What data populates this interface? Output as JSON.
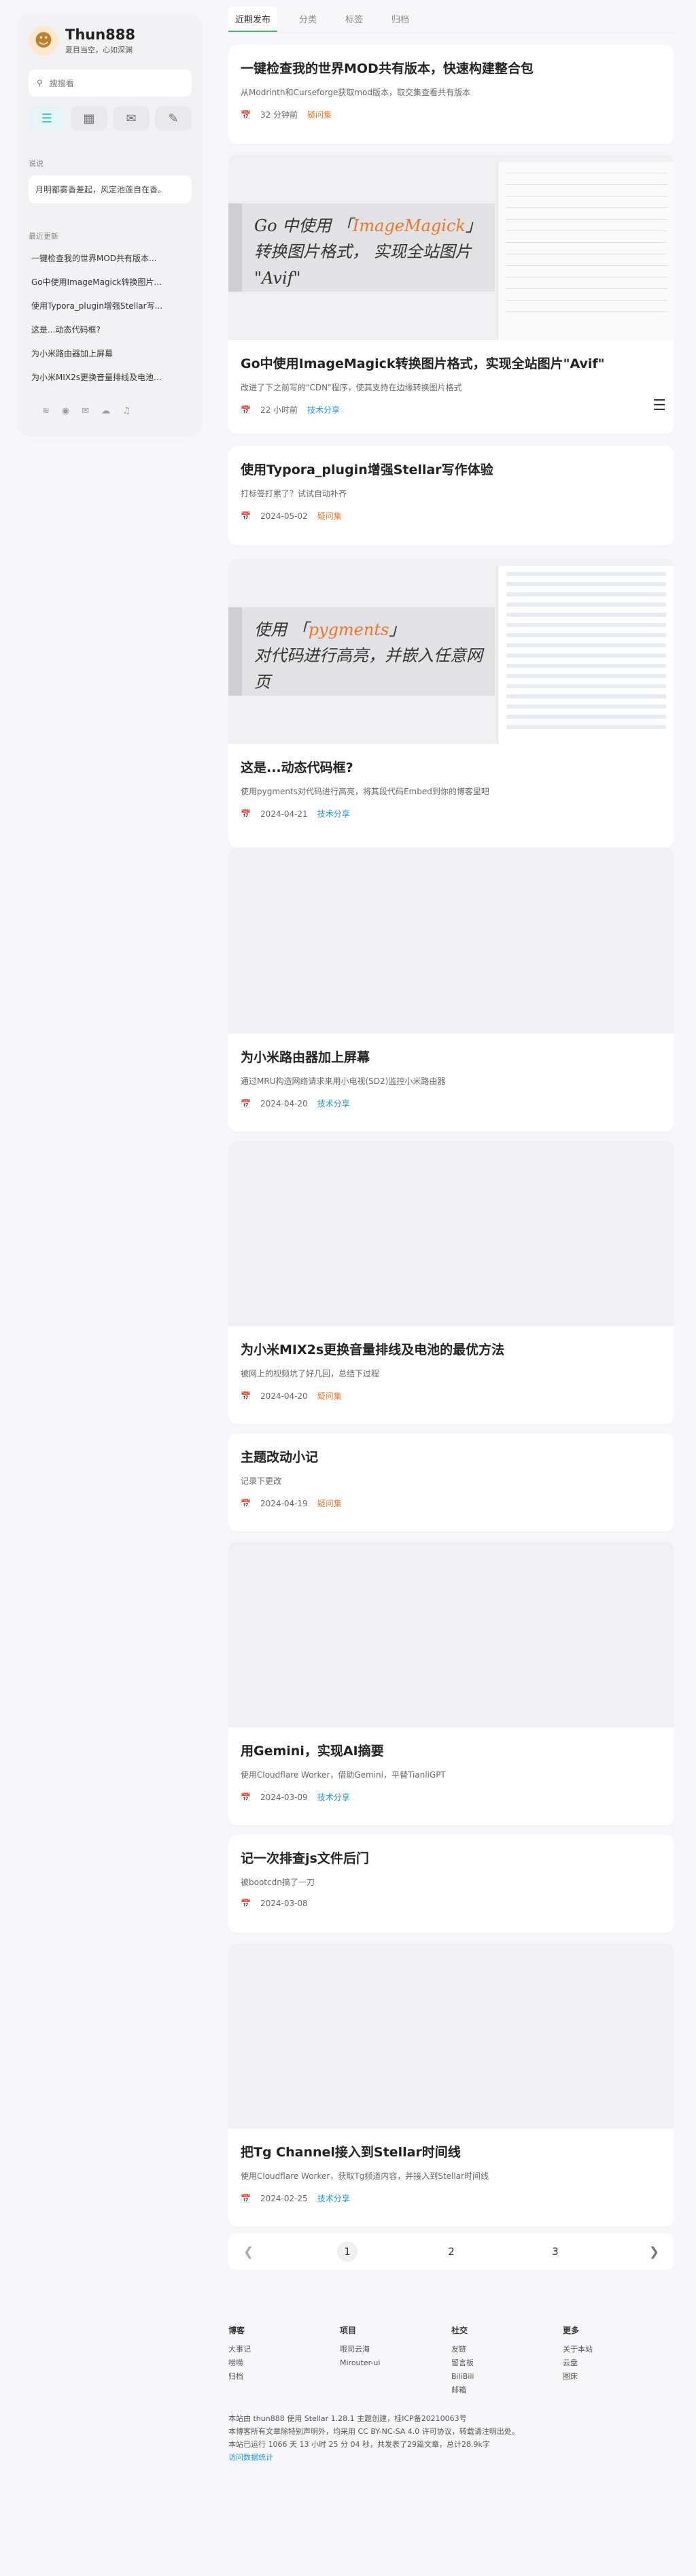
{
  "profile": {
    "name": "Thun888",
    "subtitle": "夏目当空，心如深渊"
  },
  "search": {
    "placeholder": "搜搜看"
  },
  "announcement": {
    "title": "说说",
    "text": "月明都雾香差起，风定池莲自在香。"
  },
  "recent": {
    "title": "最近更新",
    "items": [
      "一键检查我的世界MOD共有版本...",
      "Go中使用ImageMagick转换图片...",
      "使用Typora_plugin增强Stellar写...",
      "这是...动态代码框?",
      "为小米路由器加上屏幕",
      "为小米MIX2s更换音量排线及电池..."
    ]
  },
  "tabs": [
    "近期发布",
    "分类",
    "标签",
    "归档"
  ],
  "posts": [
    {
      "title": "一键检查我的世界MOD共有版本，快速构建整合包",
      "desc": "从Modrinth和Curseforge获取mod版本，取交集查看共有版本",
      "date": "32 分钟前",
      "cat": "疑问集",
      "catColor": "orange"
    },
    {
      "title": "Go中使用ImageMagick转换图片格式，实现全站图片\"Avif\"",
      "desc": "改进了下之前写的\"CDN\"程序，使其支持在边缘转换图片格式",
      "date": "22 小时前",
      "cat": "技术分享",
      "catColor": "blue",
      "cover": {
        "line1a": "Go 中使用 「",
        "line1hl": "ImageMagick",
        "line1b": "」",
        "line2": "转换图片格式， 实现全站图片 \"Avif\""
      }
    },
    {
      "title": "使用Typora_plugin增强Stellar写作体验",
      "desc": "打标签打累了？试试自动补齐",
      "date": "2024-05-02",
      "cat": "疑问集",
      "catColor": "orange"
    },
    {
      "title": "这是...动态代码框?",
      "desc": "使用pygments对代码进行高亮，将其段代码Embed到你的博客里吧",
      "date": "2024-04-21",
      "cat": "技术分享",
      "catColor": "blue",
      "cover": {
        "line1a": "使用 「",
        "line1hl": "pygments",
        "line1b": "」",
        "line2": "对代码进行高亮，并嵌入任意网页"
      }
    },
    {
      "title": "为小米路由器加上屏幕",
      "desc": "通过MRU构造网络请求来用小电视(SD2)监控小米路由器",
      "date": "2024-04-20",
      "cat": "技术分享",
      "catColor": "blue"
    },
    {
      "title": "为小米MIX2s更换音量排线及电池的最优方法",
      "desc": "被网上的视频坑了好几回，总结下过程",
      "date": "2024-04-20",
      "cat": "疑问集",
      "catColor": "orange"
    },
    {
      "title": "主题改动小记",
      "desc": "记录下更改",
      "date": "2024-04-19",
      "cat": "疑问集",
      "catColor": "orange"
    },
    {
      "title": "用Gemini，实现AI摘要",
      "desc": "使用Cloudflare Worker，借助Gemini，平替TianliGPT",
      "date": "2024-03-09",
      "cat": "技术分享",
      "catColor": "blue"
    },
    {
      "title": "记一次排查js文件后门",
      "desc": "被bootcdn搞了一刀",
      "date": "2024-03-08",
      "cat": "",
      "catColor": ""
    },
    {
      "title": "把Tg Channel接入到Stellar时间线",
      "desc": "使用Cloudflare Worker，获取Tg频道内容，并接入到Stellar时间线",
      "date": "2024-02-25",
      "cat": "技术分享",
      "catColor": "blue"
    }
  ],
  "pagination": {
    "pages": [
      "1",
      "2",
      "3"
    ],
    "current": "1"
  },
  "footer": {
    "columns": [
      {
        "title": "博客",
        "links": [
          "大事记",
          "唠唠",
          "归档"
        ]
      },
      {
        "title": "项目",
        "links": [
          "哦司云海",
          "Mirouter-ui"
        ]
      },
      {
        "title": "社交",
        "links": [
          "友链",
          "留言板",
          "BiliBili",
          "邮箱"
        ]
      },
      {
        "title": "更多",
        "links": [
          "关于本站",
          "云盘",
          "图床"
        ]
      }
    ],
    "line1": "本站由 thun888 使用 Stellar 1.28.1 主题创建，桂ICP备20210063号",
    "line2": "本博客所有文章除特别声明外，均采用 CC BY-NC-SA 4.0 许可协议，转载请注明出处。",
    "line3": "本站已运行 1066 天 13 小时 25 分 04 秒，共发表了29篇文章，总计28.9k字",
    "line4": "访问数据统计"
  }
}
